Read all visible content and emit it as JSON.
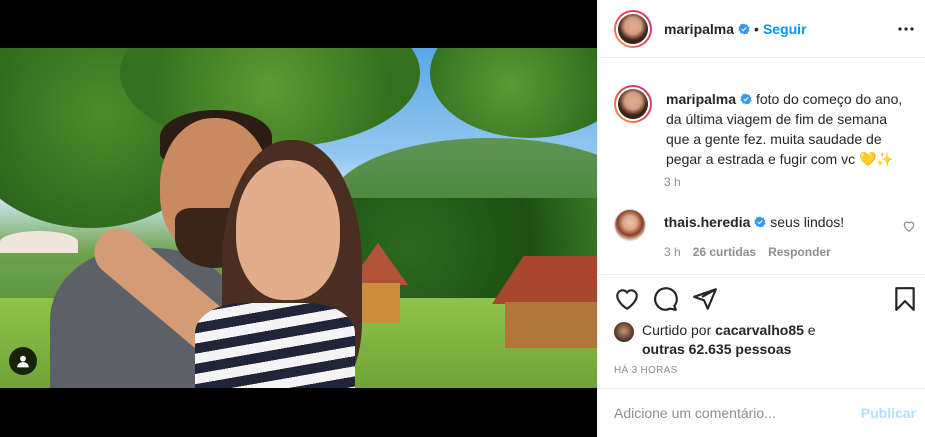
{
  "post": {
    "author": "maripalma",
    "follow_label": "Seguir",
    "separator": "•",
    "more_icon": "more-horizontal-icon",
    "caption": "foto do começo do ano, da última viagem de fim de semana que a gente fez. muita saudade de pegar a estrada e fugir com vc 💛✨",
    "caption_time": "3 h"
  },
  "comments": [
    {
      "user": "thais.heredia",
      "text": "seus lindos!",
      "time": "3 h",
      "likes": "26 curtidas",
      "reply_label": "Responder"
    }
  ],
  "actions": {
    "like_icon": "heart-icon",
    "comment_icon": "comment-icon",
    "share_icon": "send-icon",
    "save_icon": "bookmark-icon"
  },
  "likes": {
    "prefix": "Curtido por",
    "user": "cacarvalho85",
    "conj": "e",
    "others": "outras 62.635 pessoas"
  },
  "date": "HÁ 3 HORAS",
  "add_comment": {
    "placeholder": "Adicione um comentário...",
    "publish_label": "Publicar"
  },
  "colors": {
    "link": "#0095f6",
    "verified": "#3897f0",
    "muted": "#8e8e8e",
    "publish_disabled": "#b2dffc"
  }
}
